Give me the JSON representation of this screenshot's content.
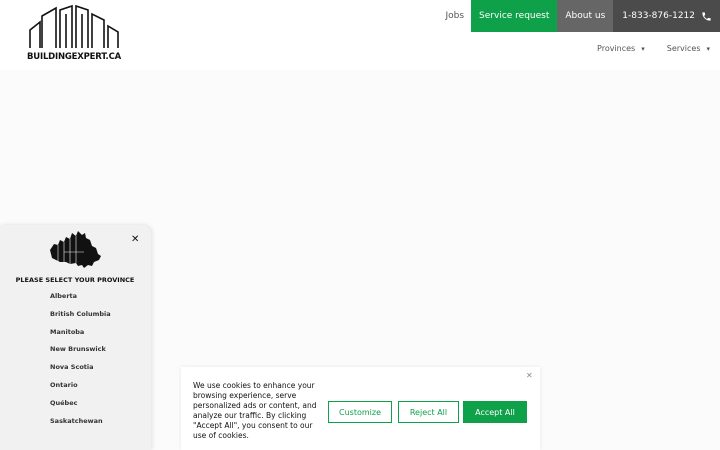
{
  "logo": {
    "text": "BUILDINGEXPERT.CA",
    "icon": "buildings-logo-icon"
  },
  "topnav": {
    "jobs": "Jobs",
    "service_request": "Service request",
    "about": "About us",
    "phone": "1-833-876-1212",
    "phone_icon": "phone-icon"
  },
  "subnav": {
    "provinces": "Provinces",
    "services": "Services"
  },
  "province_panel": {
    "heading": "PLEASE SELECT YOUR PROVINCE",
    "provinces": [
      "Alberta",
      "British Columbia",
      "Manitoba",
      "New Brunswick",
      "Nova Scotia",
      "Ontario",
      "Québec",
      "Saskatchewan"
    ]
  },
  "cookie": {
    "text": "We use cookies to enhance your browsing experience, serve personalized ads or content, and analyze our traffic. By clicking \"Accept All\", you consent to our use of cookies.",
    "customize": "Customize",
    "reject": "Reject All",
    "accept": "Accept All"
  },
  "colors": {
    "accent": "#0fa04a",
    "about_bg": "#666666",
    "phone_bg": "#4b4b4b"
  }
}
